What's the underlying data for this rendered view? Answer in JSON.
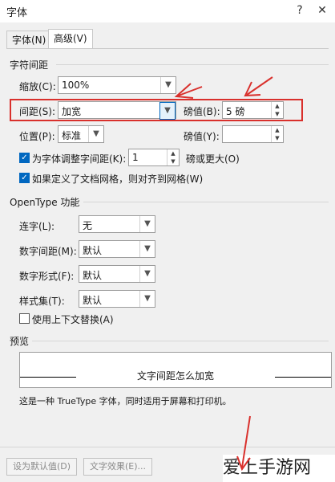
{
  "window": {
    "title": "字体",
    "help_icon": "?",
    "close_icon": "✕"
  },
  "tabs": [
    {
      "label": "字体(N)"
    },
    {
      "label": "高级(V)"
    }
  ],
  "spacing": {
    "section": "字符间距",
    "scale_label": "缩放(C):",
    "scale_value": "100%",
    "spacing_label": "间距(S):",
    "spacing_value": "加宽",
    "by_label": "磅值(B):",
    "by_value": "5 磅",
    "position_label": "位置(P):",
    "position_value": "标准",
    "pos_by_label": "磅值(Y):",
    "pos_by_value": "",
    "kerning_label": "为字体调整字间距(K):",
    "kerning_value": "1",
    "kerning_suffix": "磅或更大(O)",
    "grid_label": "如果定义了文档网格，则对齐到网格(W)"
  },
  "opentype": {
    "section": "OpenType 功能",
    "ligatures_label": "连字(L):",
    "ligatures_value": "无",
    "numspacing_label": "数字间距(M):",
    "numspacing_value": "默认",
    "numform_label": "数字形式(F):",
    "numform_value": "默认",
    "stylistic_label": "样式集(T):",
    "stylistic_value": "默认",
    "contextual_label": "使用上下文替换(A)"
  },
  "preview": {
    "section": "预览",
    "sample": "文字间距怎么加宽",
    "note": "这是一种 TrueType 字体，同时适用于屏幕和打印机。"
  },
  "footer": {
    "default_btn": "设为默认值(D)",
    "effects_btn": "文字效果(E)...",
    "watermark": "爱上手游网"
  },
  "colors": {
    "accent": "#0067c0",
    "annotation": "#d9302c"
  }
}
